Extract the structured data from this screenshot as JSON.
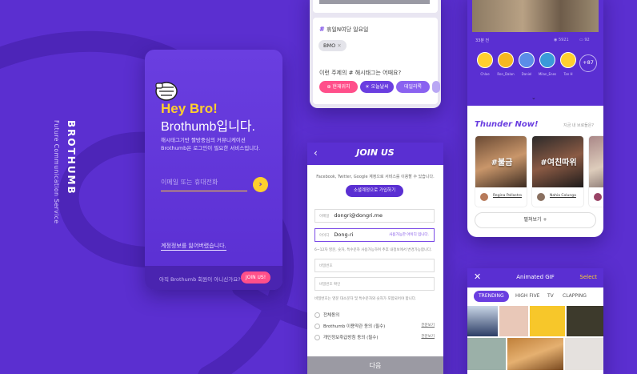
{
  "brand": {
    "title": "BROTHUMB",
    "subtitle": "Future Communication Service"
  },
  "login": {
    "greeting": "Hey Bro!",
    "headline": "Brothumb입니다.",
    "description": "해시태그기반 짤방중심의 커뮤니케이션 Brothumb은 로그인이 필요한 서비스입니다.",
    "input_placeholder": "이메일 또는 휴대전화",
    "go_label": "›",
    "lost_account": "계정정보를 잃어버렸습니다.",
    "not_member": "아직 Brothumb 회원이 아니신가요?",
    "join_label": "JOIN US!"
  },
  "hashtag": {
    "title": "휴일N여당  일요일",
    "chip": "BMO",
    "question": "이런 주제의 # 해시태그는 어때요?",
    "tags": [
      "현재위치",
      "오늘날씨",
      "데일리룩"
    ]
  },
  "join": {
    "title": "JOIN US",
    "sns_desc": "Facebook, Twitter, Google 계정으로 서비스를 이용할 수 있습니다.",
    "sns_button": "소셜계정으로 가입하기",
    "email_label": "이메일",
    "email_value": "dongri@dongri.me",
    "id_label": "아이디",
    "id_value": "Dong-ri",
    "id_ok": "사용가능한 아이디 입니다.",
    "id_note": "6~12자 영문, 숫자, 특수문자 사용가능하며 추후 내정보에서 변경가능합니다.",
    "password_label": "비밀번호",
    "password_confirm_label": "비밀번호 확인",
    "password_note": "비밀번호는 영문 대소문자 및 특수문자와 숫자가 포함되어야 합니다.",
    "checks": [
      {
        "label": "전체동의",
        "view": ""
      },
      {
        "label": "Brothumb 이용약관 동의 (필수)",
        "view": "전문보기"
      },
      {
        "label": "개인정보취급방침 동의 (필수)",
        "view": "전문보기"
      }
    ],
    "next_label": "다음"
  },
  "thunder": {
    "time": "33분 전",
    "views": "5921",
    "comments": "92",
    "reactions": [
      "Chloe",
      "Ron_Dalan",
      "Daniel",
      "Milan_Enes",
      "Tan H"
    ],
    "more": "+87",
    "title": "Thunder Now!",
    "now_label": "지금 내 브로들은?",
    "cards": [
      {
        "tag": "#불금",
        "name": "Regina Pollastro"
      },
      {
        "tag": "#여친따위",
        "name": "Nahia Colunga"
      }
    ],
    "more_button": "펼쳐보기 +"
  },
  "gif": {
    "title": "Animated GIF",
    "select_label": "Select",
    "tabs": [
      "TRENDING",
      "HIGH FIVE",
      "TV",
      "CLAPPING"
    ]
  },
  "colors": {
    "background": "#5b2fd0",
    "accent": "#ffcf2e",
    "pink": "#ff4f8a",
    "primary": "#6a3ee0"
  }
}
